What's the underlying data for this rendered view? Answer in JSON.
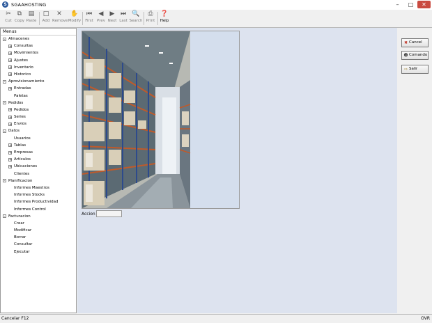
{
  "window": {
    "title": "SGAAHOSTING"
  },
  "toolbar": [
    {
      "label": "Cut",
      "icon": "scissors-icon",
      "enabled": false
    },
    {
      "label": "Copy",
      "icon": "copy-icon",
      "enabled": false
    },
    {
      "label": "Paste",
      "icon": "paste-icon",
      "enabled": false
    },
    {
      "label": "Add",
      "icon": "new-document-icon",
      "enabled": false
    },
    {
      "label": "Remove",
      "icon": "delete-x-icon",
      "enabled": false
    },
    {
      "label": "Modify",
      "icon": "hand-icon",
      "enabled": false
    },
    {
      "label": "First",
      "icon": "first-record-icon",
      "enabled": false
    },
    {
      "label": "Prev",
      "icon": "previous-record-icon",
      "enabled": false
    },
    {
      "label": "Next",
      "icon": "next-record-icon",
      "enabled": false
    },
    {
      "label": "Last",
      "icon": "last-record-icon",
      "enabled": false
    },
    {
      "label": "Search",
      "icon": "binoculars-icon",
      "enabled": false
    },
    {
      "label": "Print",
      "icon": "printer-icon",
      "enabled": false
    },
    {
      "label": "Help",
      "icon": "help-icon",
      "enabled": true
    }
  ],
  "menu": {
    "header": "Menus",
    "items": [
      {
        "label": "Almacenes",
        "level": 0,
        "expander": "-"
      },
      {
        "label": "Consultas",
        "level": 1,
        "expander": "+"
      },
      {
        "label": "Movimientos",
        "level": 1,
        "expander": "+"
      },
      {
        "label": "Ajustes",
        "level": 1,
        "expander": "+"
      },
      {
        "label": "Inventario",
        "level": 1,
        "expander": "+"
      },
      {
        "label": "Historico",
        "level": 1,
        "expander": "+"
      },
      {
        "label": "Aprovisionamiento",
        "level": 0,
        "expander": "-"
      },
      {
        "label": "Entradas",
        "level": 1,
        "expander": "+"
      },
      {
        "label": "Paletas",
        "level": 1,
        "expander": ""
      },
      {
        "label": "Pedidos",
        "level": 0,
        "expander": "-"
      },
      {
        "label": "Pedidos",
        "level": 1,
        "expander": "+"
      },
      {
        "label": "Series",
        "level": 1,
        "expander": "+"
      },
      {
        "label": "Envios",
        "level": 1,
        "expander": "+"
      },
      {
        "label": "Datos",
        "level": 0,
        "expander": "-"
      },
      {
        "label": "Usuarios",
        "level": 1,
        "expander": ""
      },
      {
        "label": "Tablas",
        "level": 1,
        "expander": "+"
      },
      {
        "label": "Empresas",
        "level": 1,
        "expander": "+"
      },
      {
        "label": "Articulos",
        "level": 1,
        "expander": "+"
      },
      {
        "label": "Ubicaciones",
        "level": 1,
        "expander": "+"
      },
      {
        "label": "Clientes",
        "level": 1,
        "expander": ""
      },
      {
        "label": "Planificacion",
        "level": 0,
        "expander": "-"
      },
      {
        "label": "Informes Maestros",
        "level": 1,
        "expander": ""
      },
      {
        "label": "Informes Stocks",
        "level": 1,
        "expander": ""
      },
      {
        "label": "Informes Productividad",
        "level": 1,
        "expander": ""
      },
      {
        "label": "Informes Control",
        "level": 1,
        "expander": ""
      },
      {
        "label": "Facturacion",
        "level": 0,
        "expander": "-"
      },
      {
        "label": "Crear",
        "level": 1,
        "expander": ""
      },
      {
        "label": "Modificar",
        "level": 1,
        "expander": ""
      },
      {
        "label": "Borrar",
        "level": 1,
        "expander": ""
      },
      {
        "label": "Consultar",
        "level": 1,
        "expander": ""
      },
      {
        "label": "Ejecutar",
        "level": 1,
        "expander": ""
      }
    ]
  },
  "form": {
    "accion_label": "Accion",
    "accion_value": ""
  },
  "side_buttons": [
    {
      "label": "Cancel",
      "icon": "cancel-icon"
    },
    {
      "label": "Comando",
      "icon": "user-command-icon"
    },
    {
      "label": "Salir",
      "icon": "exit-door-icon"
    }
  ],
  "status": {
    "left": "Cancelar F12",
    "right": "OVR"
  }
}
